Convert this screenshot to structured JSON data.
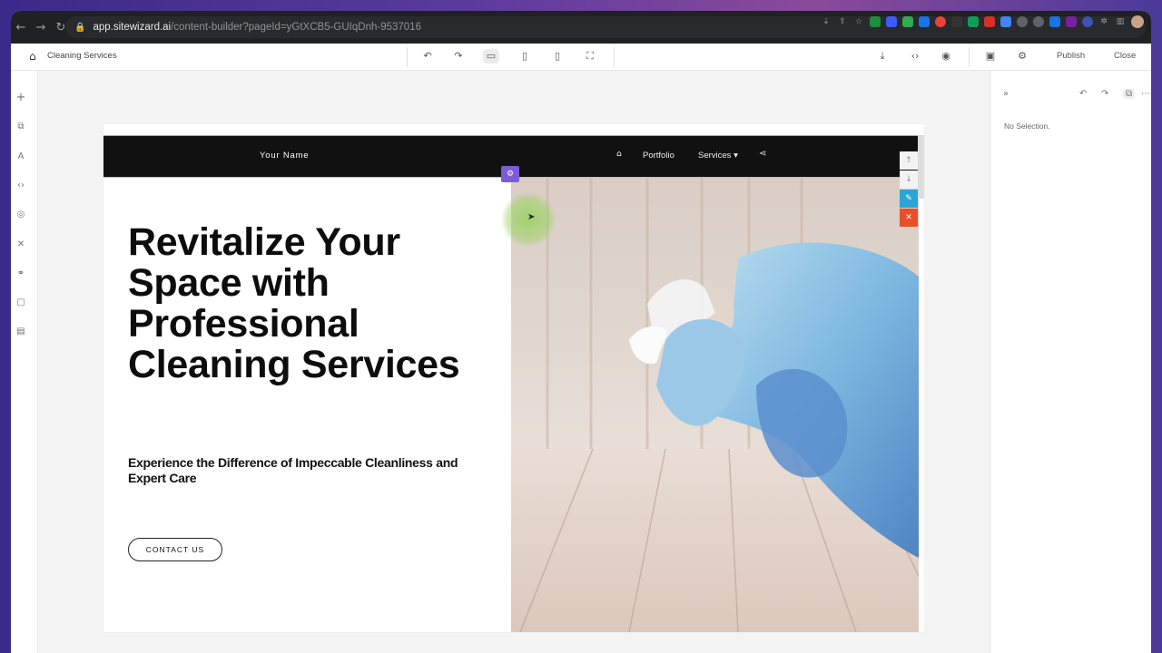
{
  "browser": {
    "url_host": "app.sitewizard.ai",
    "url_path": "/content-builder?pageId=yGtXCB5-GUIqDnh-9537016"
  },
  "editor": {
    "page_name": "Cleaning Services",
    "publish_label": "Publish",
    "close_label": "Close",
    "panel_empty": "No Selection."
  },
  "site": {
    "brand": "Your Name",
    "nav": [
      "Portfolio",
      "Services ▾"
    ],
    "hero_title": "Revitalize Your Space with Professional Cleaning Services",
    "hero_subtitle": "Experience the Difference of Impeccable Cleanliness and Expert Care",
    "cta_label": "CONTACT US"
  },
  "colors": {
    "selection_badge": "#7b5cd6",
    "tool_blue": "#2aa6d6",
    "tool_red": "#e8502a",
    "selection_line": "#7fdcbc"
  }
}
